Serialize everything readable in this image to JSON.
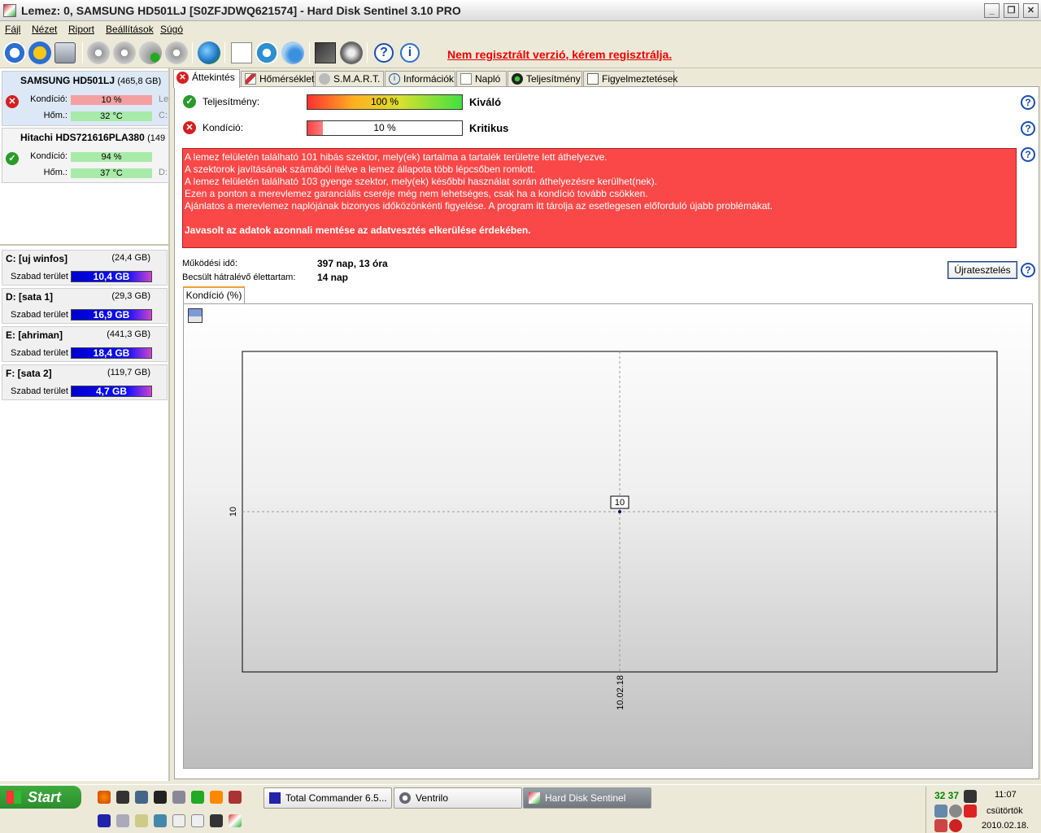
{
  "window": {
    "title": "Lemez: 0, SAMSUNG HD501LJ [S0ZFJDWQ621574]  -  Hard Disk Sentinel 3.10 PRO",
    "minimize": "_",
    "maximize": "❐",
    "close": "✕"
  },
  "menu": [
    "Fájl",
    "Nézet",
    "Riport",
    "Beállítások",
    "Súgó"
  ],
  "toolbar": {
    "register_link": "Nem regisztrált verzió, kérem regisztrálja."
  },
  "disks": [
    {
      "name": "SAMSUNG HD501LJ",
      "size": "(465,8 GB)",
      "condition_label": "Kondíció:",
      "condition": "10 %",
      "condition_pct": 10,
      "temp_label": "Hőm.:",
      "temp": "32 °C",
      "side1": "Le",
      "side2": "C:",
      "status": "bad"
    },
    {
      "name": "Hitachi HDS721616PLA380",
      "size": "(149",
      "condition_label": "Kondíció:",
      "condition": "94 %",
      "condition_pct": 94,
      "temp_label": "Hőm.:",
      "temp": "37 °C",
      "side1": "",
      "side2": "D:",
      "status": "ok"
    }
  ],
  "partitions": [
    {
      "name": "C: [uj winfos]",
      "size": "(24,4 GB)",
      "free_label": "Szabad terület",
      "free": "10,4 GB"
    },
    {
      "name": "D: [sata 1]",
      "size": "(29,3 GB)",
      "free_label": "Szabad terület",
      "free": "16,9 GB"
    },
    {
      "name": "E: [ahriman]",
      "size": "(441,3 GB)",
      "free_label": "Szabad terület",
      "free": "18,4 GB"
    },
    {
      "name": "F: [sata 2]",
      "size": "(119,7 GB)",
      "free_label": "Szabad terület",
      "free": "4,7 GB"
    }
  ],
  "tabs": [
    "Áttekintés",
    "Hőmérséklet",
    "S.M.A.R.T.",
    "Információk",
    "Napló",
    "Teljesítmény",
    "Figyelmeztetések"
  ],
  "overview": {
    "performance_label": "Teljesítmény:",
    "performance_value": "100 %",
    "performance_pct": 100,
    "performance_word": "Kiváló",
    "condition_label": "Kondíció:",
    "condition_value": "10 %",
    "condition_pct": 10,
    "condition_word": "Kritikus",
    "help": "?",
    "alert_lines": [
      "A lemez felületén található 101 hibás szektor, mely(ek) tartalma a tartalék területre lett áthelyezve.",
      "A szektorok javításának számából ítélve a lemez állapota több lépcsőben romlott.",
      "A lemez felületén található 103 gyenge szektor, mely(ek) későbbi használat során áthelyezésre kerülhet(nek).",
      "Ezen a ponton a merevlemez garanciális cseréje még nem lehetséges, csak ha a kondíció tovább csökken.",
      "Ajánlatos a merevlemez naplójának bizonyos időközönkénti figyelése. A program itt tárolja az esetlegesen előforduló újabb problémákat."
    ],
    "alert_strong": "Javasolt az adatok azonnali mentése az adatvesztés elkerülése érdekében.",
    "uptime_label": "Működési idő:",
    "uptime": "397 nap, 13 óra",
    "remaining_label": "Becsült hátralévő élettartam:",
    "remaining": "14 nap",
    "retest_button": "Újratesztelés",
    "subtab": "Kondíció  (%)"
  },
  "chart_data": {
    "type": "line",
    "x": [
      "10.02.18"
    ],
    "series": [
      {
        "values": [
          10
        ]
      }
    ],
    "data_labels": [
      "10"
    ],
    "y_ticks": [
      "10"
    ],
    "x_ticks": [
      "10.02.18"
    ],
    "grid": "dashed crosshair"
  },
  "taskbar": {
    "start": "Start",
    "tasks": [
      "Total Commander 6.5...",
      "Ventrilo",
      "Hard Disk Sentinel"
    ],
    "active_task": 2,
    "tray_temps": "32 37",
    "clock": "11:07",
    "day": "csütörtök",
    "date": "2010.02.18."
  }
}
